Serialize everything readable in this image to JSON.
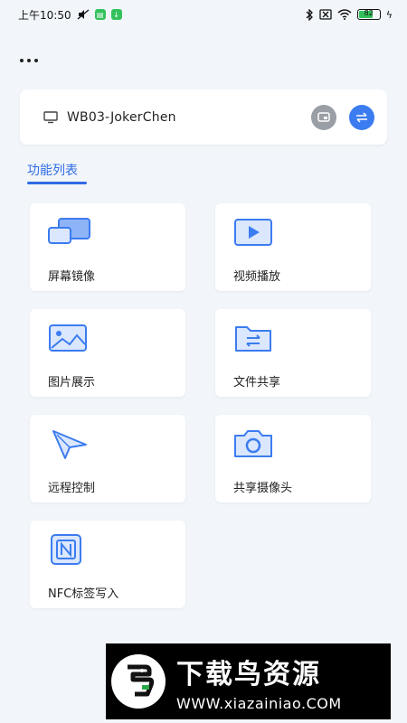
{
  "status_bar": {
    "time": "上午10:50",
    "battery_level": "82"
  },
  "device": {
    "name": "WB03-JokerChen"
  },
  "section": {
    "title": "功能列表"
  },
  "features": [
    {
      "label": "屏幕镜像",
      "icon": "screen-mirror-icon"
    },
    {
      "label": "视频播放",
      "icon": "video-play-icon"
    },
    {
      "label": "图片展示",
      "icon": "image-icon"
    },
    {
      "label": "文件共享",
      "icon": "folder-share-icon"
    },
    {
      "label": "远程控制",
      "icon": "remote-cursor-icon"
    },
    {
      "label": "共享摄像头",
      "icon": "camera-icon"
    },
    {
      "label": "NFC标签写入",
      "icon": "nfc-icon"
    }
  ],
  "watermark": {
    "title": "下载鸟资源",
    "url": "WWW.xiazainiao.COM"
  },
  "colors": {
    "accent": "#2f6ce5",
    "icon_blue": "#3b7cf0",
    "background": "#f2f6fb"
  }
}
